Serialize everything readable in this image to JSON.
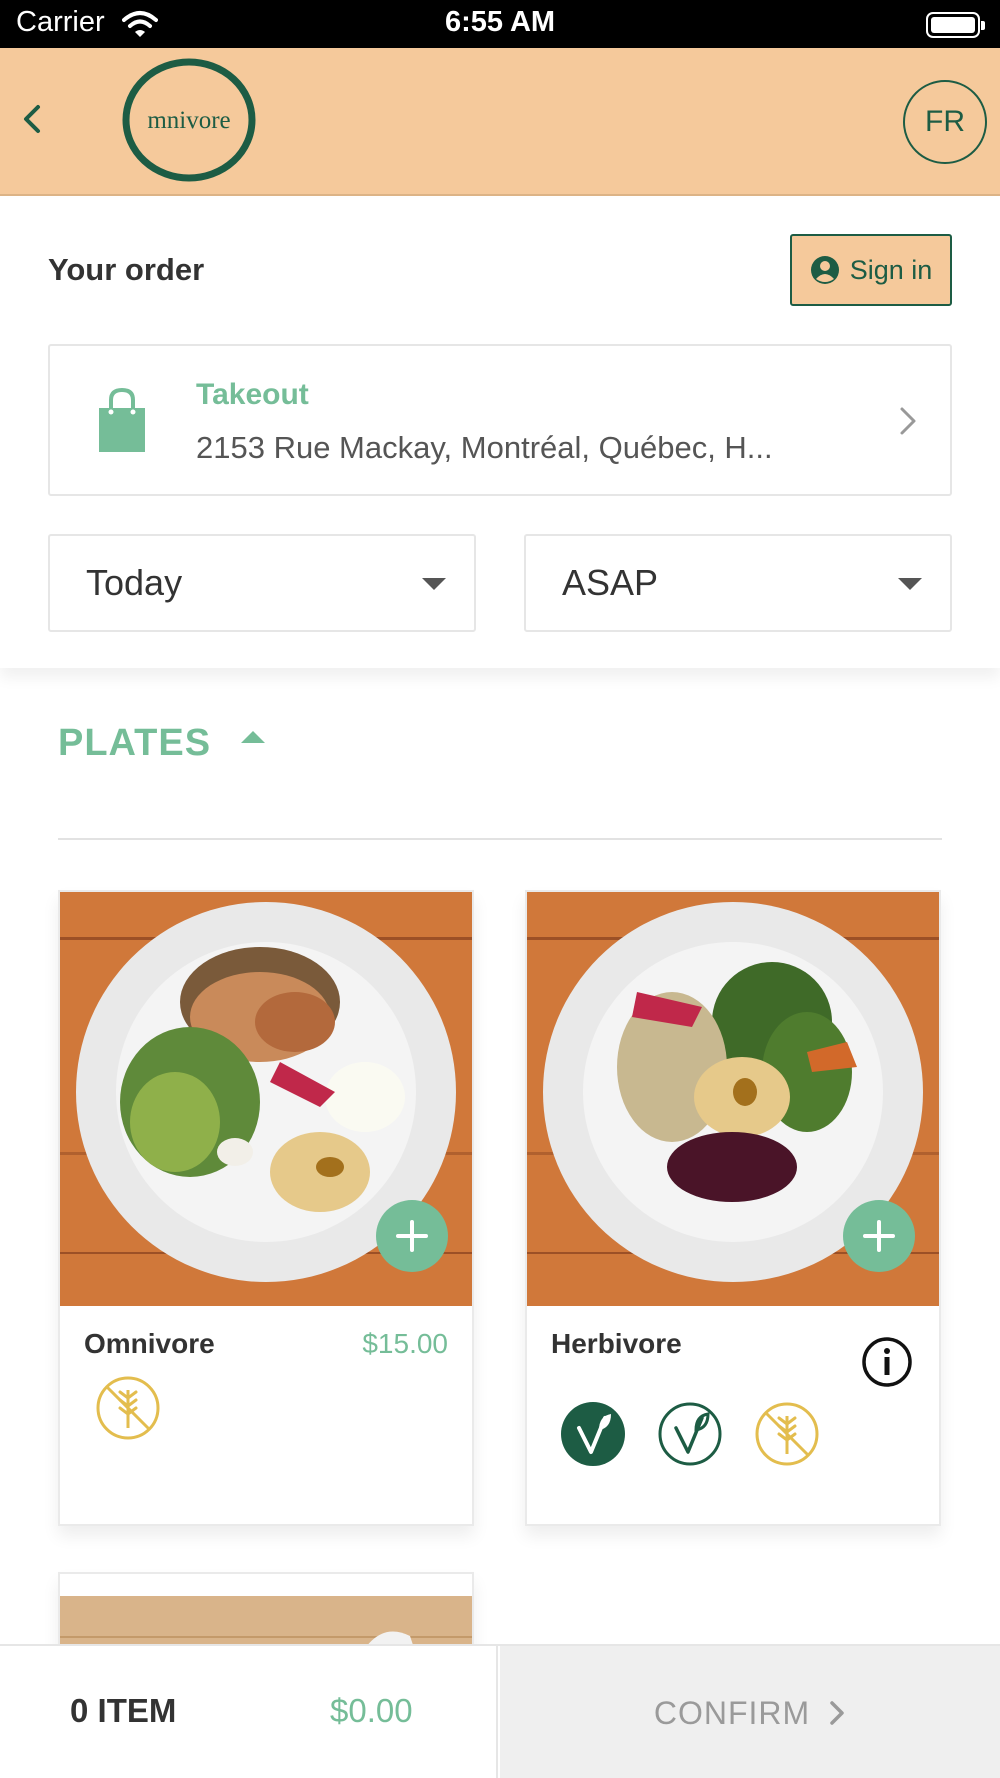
{
  "status_bar": {
    "carrier": "Carrier",
    "time": "6:55 AM"
  },
  "header": {
    "logo_initial": "O",
    "logo_text": "mnivore",
    "language_button": "FR"
  },
  "order": {
    "title": "Your order",
    "sign_in": "Sign in",
    "mode": "Takeout",
    "address": "2153 Rue Mackay, Montréal, Québec, H...",
    "date": "Today",
    "time": "ASAP"
  },
  "category": {
    "title": "PLATES"
  },
  "products": [
    {
      "name": "Omnivore",
      "price": "$15.00",
      "diet_icons": [
        "gluten-free-icon"
      ]
    },
    {
      "name": "Herbivore",
      "price": "",
      "diet_icons": [
        "vegan-icon",
        "vegetarian-icon",
        "gluten-free-icon"
      ]
    }
  ],
  "cart": {
    "count": "0 ITEM",
    "total": "$0.00",
    "confirm": "CONFIRM"
  },
  "colors": {
    "header_bg": "#f5c99b",
    "brand_green": "#1d5c44",
    "accent_green": "#75bd98",
    "gluten_gold": "#e3bd4e"
  }
}
